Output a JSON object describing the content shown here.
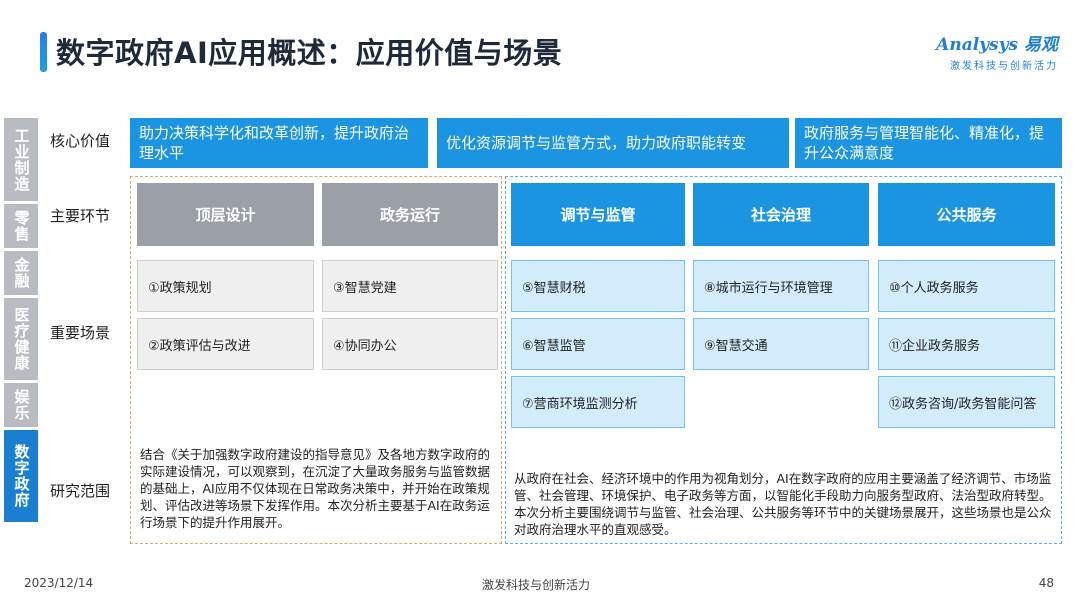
{
  "title": "数字政府AI应用概述：应用价值与场景",
  "logo": {
    "main": "Analysys 易观",
    "sub": "激发科技与创新活力"
  },
  "tabs": [
    "工业制造",
    "零售",
    "金融",
    "医疗健康",
    "娱乐",
    "数字政府"
  ],
  "row_labels": {
    "core_value": "核心价值",
    "main_link": "主要环节",
    "key_scene": "重要场景",
    "research": "研究范围"
  },
  "core_values": [
    "助力决策科学化和改革创新，提升政府治理水平",
    "优化资源调节与监管方式，助力政府职能转变",
    "政府服务与管理智能化、精准化，提升公众满意度"
  ],
  "stages": [
    "顶层设计",
    "政务运行",
    "调节与监管",
    "社会治理",
    "公共服务"
  ],
  "scenes": {
    "design": [
      "①政策规划",
      "②政策评估与改进"
    ],
    "operation": [
      "③智慧党建",
      "④协同办公"
    ],
    "regulation": [
      "⑤智慧财税",
      "⑥智慧监管",
      "⑦营商环境监测分析"
    ],
    "governance": [
      "⑧城市运行与环境管理",
      "⑨智慧交通"
    ],
    "public": [
      "⑩个人政务服务",
      "⑪企业政务服务",
      "⑫政务咨询/政务智能问答"
    ]
  },
  "research_left": "结合《关于加强数字政府建设的指导意见》及各地方数字政府的实际建设情况，可以观察到，在沉淀了大量政务服务与监管数据的基础上，AI应用不仅体现在日常政务决策中，并开始在政策规划、评估改进等场景下发挥作用。本次分析主要基于AI在政务运行场景下的提升作用展开。",
  "research_right": "从政府在社会、经济环境中的作用为视角划分，AI在数字政府的应用主要涵盖了经济调节、市场监管、社会管理、环境保护、电子政务等方面，以智能化手段助力向服务型政府、法治型政府转型。本次分析主要围绕调节与监管、社会治理、公共服务等环节中的关键场景展开，这些场景也是公众对政府治理水平的直观感受。",
  "footer": {
    "date": "2023/12/14",
    "slogan": "激发科技与创新活力",
    "page": "48"
  }
}
